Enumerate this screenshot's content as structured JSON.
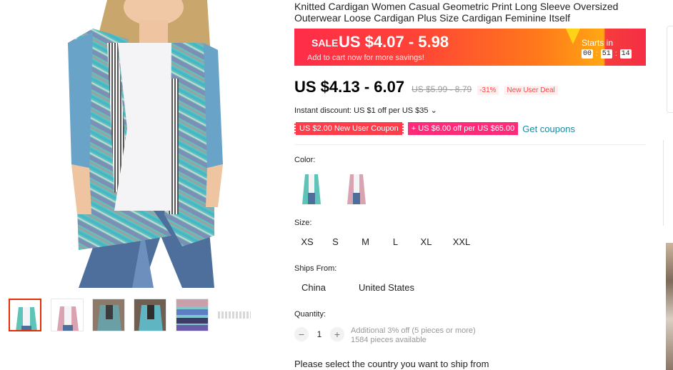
{
  "product": {
    "title": "Knitted Cardigan Women Casual Geometric Print Long Sleeve Oversized Outerwear Loose Cardigan Plus Size Cardigan Feminine Itself"
  },
  "sale_banner": {
    "tag": "SALE",
    "price": "US $4.07 - 5.98",
    "subtitle": "Add to cart now for more savings!",
    "starts_in_label": "Starts in",
    "countdown": [
      "00",
      "51",
      "14"
    ]
  },
  "price": {
    "current": "US $4.13 - 6.07",
    "original": "US $5.99 - 8.79",
    "discount": "-31%",
    "new_user_deal": "New User Deal"
  },
  "instant_discount": "Instant discount: US $1 off per US $35 ⌄",
  "coupons": {
    "coupon1": "US $2.00 New User Coupon",
    "coupon2": "+ US $6.00 off per US $65.00",
    "get_coupons": "Get coupons"
  },
  "color": {
    "label": "Color:",
    "options": [
      "blue-green-stripe",
      "pink-stripe"
    ]
  },
  "size": {
    "label": "Size:",
    "options": [
      "XS",
      "S",
      "M",
      "L",
      "XL",
      "XXL"
    ]
  },
  "ships_from": {
    "label": "Ships From:",
    "options": [
      "China",
      "United States"
    ]
  },
  "quantity": {
    "label": "Quantity:",
    "value": "1",
    "minus": "−",
    "plus": "+",
    "additional": "Additional 3% off (5 pieces or more)",
    "available": "1584 pieces available"
  },
  "ship_warning": "Please select the country you want to ship from",
  "colors": {
    "accent_red": "#ff2c49",
    "coupon_pink": "#ff2a7a",
    "link_teal": "#1a8ba3"
  }
}
